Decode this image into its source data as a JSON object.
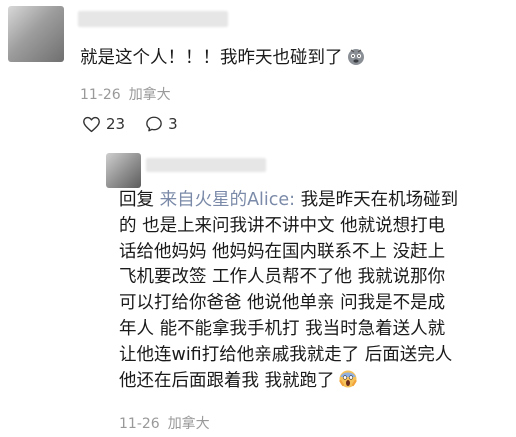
{
  "comment": {
    "text": "就是这个人！！！我昨天也碰到了",
    "emoji": "scared-face-emoji",
    "date": "11-26",
    "location": "加拿大",
    "likes": "23",
    "replies": "3"
  },
  "reply": {
    "prefix": "回复",
    "mention": "来自火星的Alice:",
    "lines": [
      " 我是昨天在机场碰到",
      "的 也是上来问我讲不讲中文 他就说想打电",
      "话给他妈妈 他妈妈在国内联系不上 没赶上",
      "飞机要改签 工作人员帮不了他 我就说那你",
      "可以打给你爸爸 他说他单亲 问我是不是成",
      "年人 能不能拿我手机打 我当时急着送人就",
      "让他连wifi打给他亲戚我就走了 后面送完人",
      "他还在后面跟着我 我就跑了"
    ],
    "emoji": "screaming-face-emoji",
    "date": "11-26",
    "location": "加拿大"
  },
  "colors": {
    "text": "#1a1a1a",
    "meta": "#999999",
    "mention": "#7a8aa8"
  }
}
